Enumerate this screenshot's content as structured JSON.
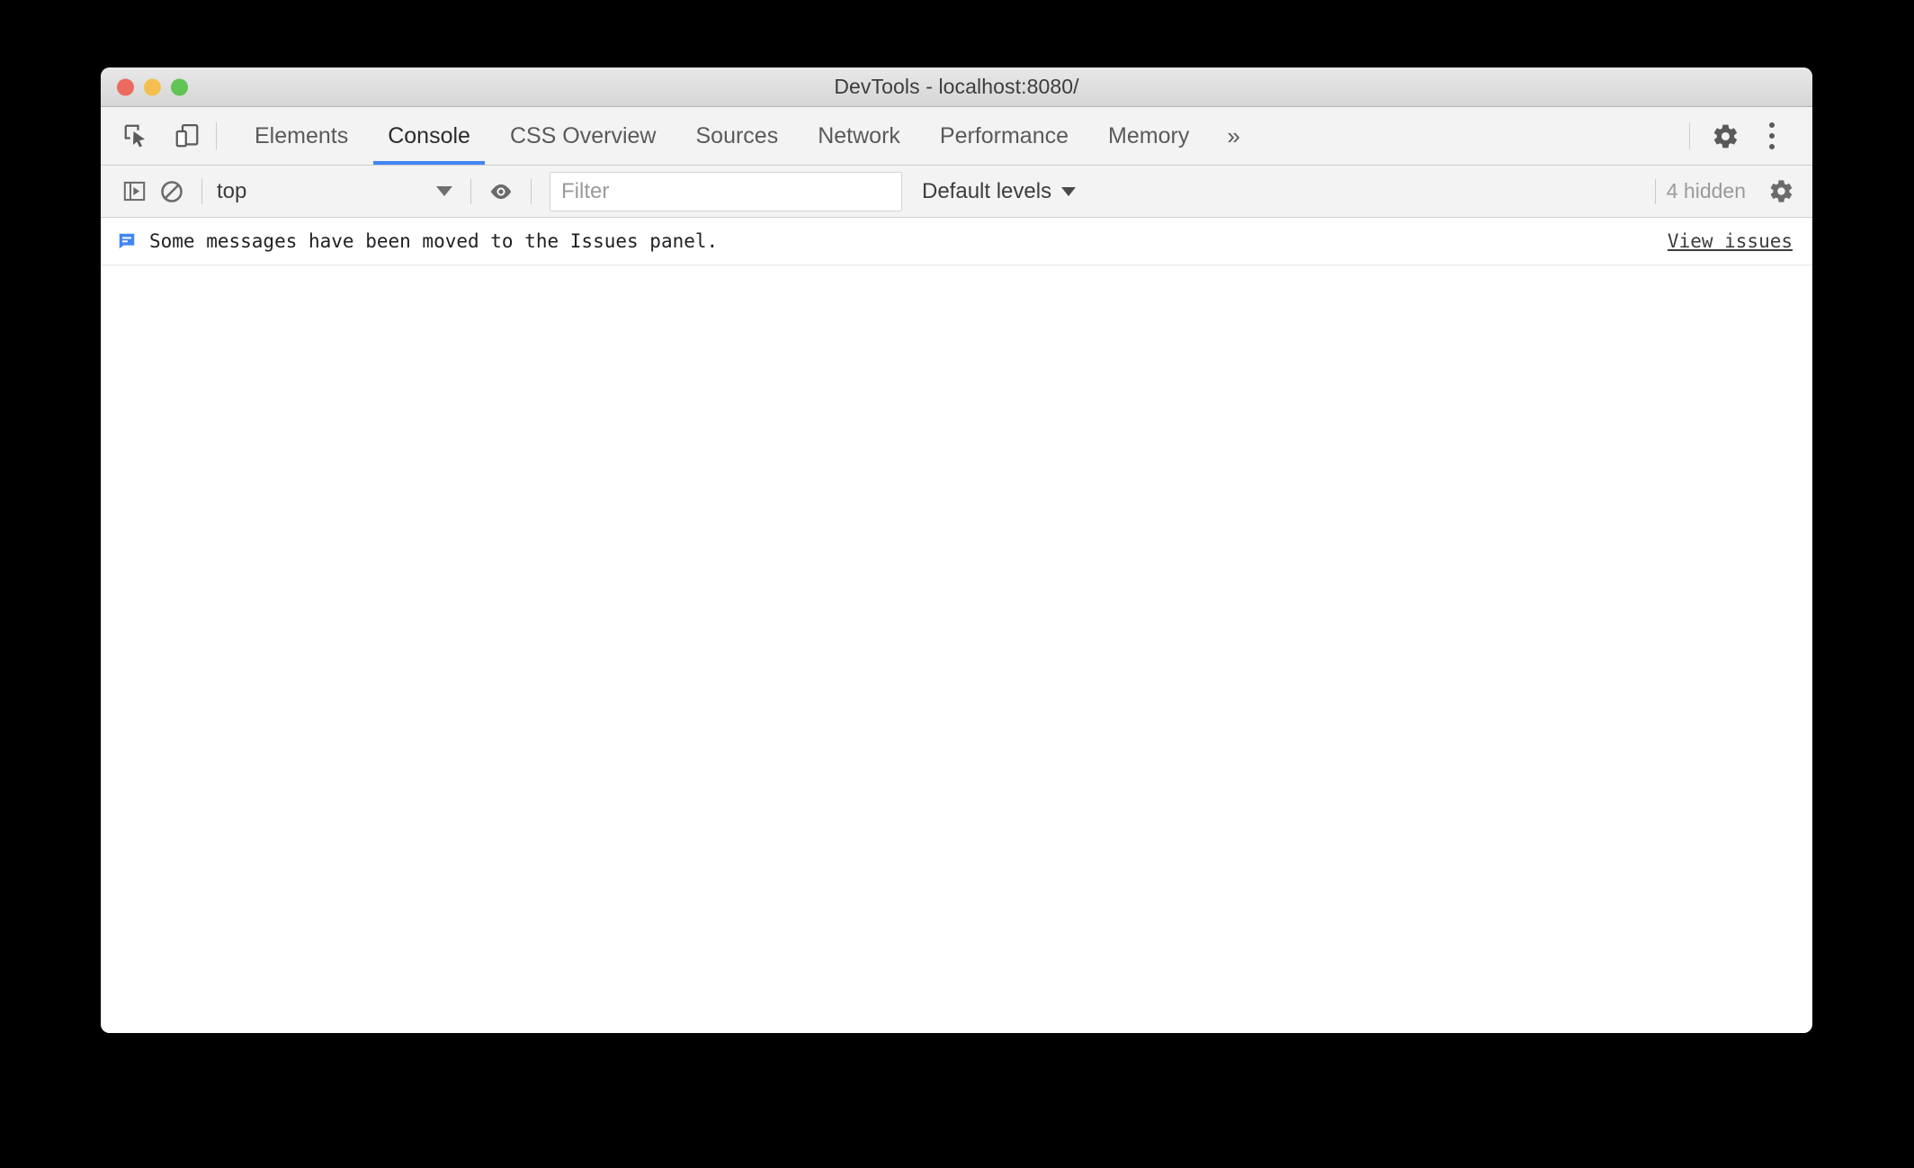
{
  "window": {
    "title": "DevTools - localhost:8080/",
    "traffic_lights": [
      {
        "name": "close",
        "color": "#ed6a5e"
      },
      {
        "name": "minimize",
        "color": "#f5bf4f"
      },
      {
        "name": "zoom",
        "color": "#61c454"
      }
    ]
  },
  "tabbar": {
    "left_icons": [
      {
        "icon": "inspect-element-icon",
        "label": "Inspect element"
      },
      {
        "icon": "device-toolbar-icon",
        "label": "Toggle device toolbar"
      }
    ],
    "tabs": [
      {
        "label": "Elements",
        "active": false
      },
      {
        "label": "Console",
        "active": true
      },
      {
        "label": "CSS Overview",
        "active": false
      },
      {
        "label": "Sources",
        "active": false
      },
      {
        "label": "Network",
        "active": false
      },
      {
        "label": "Performance",
        "active": false
      },
      {
        "label": "Memory",
        "active": false
      }
    ],
    "more_tabs_label": "»",
    "right_icons": [
      {
        "icon": "gear-icon",
        "label": "Settings"
      },
      {
        "icon": "kebab-menu-icon",
        "label": "Customize and control DevTools"
      }
    ],
    "active_underline_color": "#4285f4"
  },
  "console_toolbar": {
    "sidebar_toggle_icon": "console-sidebar-icon",
    "clear_console_icon": "clear-console-icon",
    "context": {
      "value": "top",
      "caret": "chevron-down-icon"
    },
    "live_expression_icon": "eye-icon",
    "filter": {
      "value": "",
      "placeholder": "Filter"
    },
    "levels": {
      "label": "Default levels",
      "caret": "chevron-down-icon"
    },
    "hidden_count": "4 hidden",
    "settings_icon": "gear-icon"
  },
  "console": {
    "messages": [
      {
        "icon": "issue-message-icon",
        "icon_color": "#4285f4",
        "text": "Some messages have been moved to the Issues panel.",
        "action_label": "View issues"
      }
    ]
  }
}
